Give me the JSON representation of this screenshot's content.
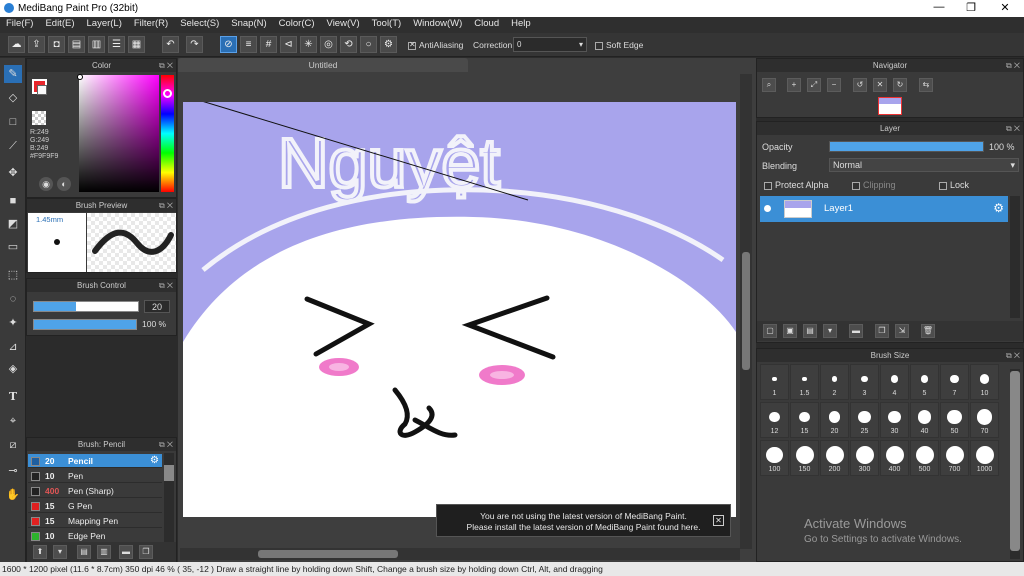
{
  "app": {
    "title": "MediBang Paint Pro (32bit)"
  },
  "window_controls": {
    "minimize": "—",
    "maximize": "❐",
    "close": "✕"
  },
  "menu": [
    "File(F)",
    "Edit(E)",
    "Layer(L)",
    "Filter(R)",
    "Select(S)",
    "Snap(N)",
    "Color(C)",
    "View(V)",
    "Tool(T)",
    "Window(W)",
    "Cloud",
    "Help"
  ],
  "toolbar": {
    "antialiasing_label": "AntiAliasing",
    "correction_label": "Correction",
    "correction_value": "0",
    "soft_edge_label": "Soft Edge"
  },
  "color_panel": {
    "title": "Color",
    "r": "R:249",
    "g": "G:249",
    "b": "B:249",
    "hex": "#F9F9F9",
    "primary_color": "#e8262c",
    "selected_color": "#f9f9f9"
  },
  "brush_preview": {
    "title": "Brush Preview",
    "size": "1.45mm"
  },
  "brush_control": {
    "title": "Brush Control",
    "size_value": "20",
    "opacity_value": "100 %"
  },
  "brush_list": {
    "title": "Brush: Pencil",
    "items": [
      {
        "size": "20",
        "name": "Pencil",
        "color": "#1e5fa0",
        "selected": true,
        "size_color": "#ffffff"
      },
      {
        "size": "10",
        "name": "Pen",
        "color": "#222222",
        "size_color": "#eeeeee"
      },
      {
        "size": "400",
        "name": "Pen (Sharp)",
        "color": "#222222",
        "size_color": "#e05555"
      },
      {
        "size": "15",
        "name": "G Pen",
        "color": "#e02020",
        "size_color": "#eeeeee"
      },
      {
        "size": "15",
        "name": "Mapping Pen",
        "color": "#e02020",
        "size_color": "#eeeeee"
      },
      {
        "size": "10",
        "name": "Edge Pen",
        "color": "#2db32d",
        "size_color": "#eeeeee"
      }
    ]
  },
  "canvas_tab": {
    "title": "Untitled"
  },
  "canvas": {
    "handwritten_text": "Nguyệt",
    "background_color": "#a8a4ec"
  },
  "notification": {
    "line1": "You are not using the latest version of MediBang Paint.",
    "line2": "Please install the latest version of MediBang Paint found here.",
    "close": "✕"
  },
  "navigator": {
    "title": "Navigator"
  },
  "layer_panel": {
    "title": "Layer",
    "opacity_label": "Opacity",
    "opacity_value": "100 %",
    "opacity_fraction": 1.0,
    "blending_label": "Blending",
    "blending_value": "Normal",
    "protect_alpha": "Protect Alpha",
    "clipping": "Clipping",
    "lock": "Lock",
    "layers": [
      {
        "name": "Layer1",
        "visible": true
      }
    ]
  },
  "brush_size": {
    "title": "Brush Size",
    "sizes": [
      "1",
      "1.5",
      "2",
      "3",
      "4",
      "5",
      "7",
      "10",
      "12",
      "15",
      "20",
      "25",
      "30",
      "40",
      "50",
      "70",
      "100",
      "150",
      "200",
      "300",
      "400",
      "500",
      "700",
      "1000"
    ]
  },
  "watermark": {
    "line1": "Activate Windows",
    "line2": "Go to Settings to activate Windows."
  },
  "status": {
    "text": "1600 * 1200 pixel   (11.6 * 8.7cm)  350 dpi   46 %   ( 35, -12 )   Draw a straight line by holding down Shift, Change a brush size by holding down Ctrl, Alt, and dragging"
  }
}
